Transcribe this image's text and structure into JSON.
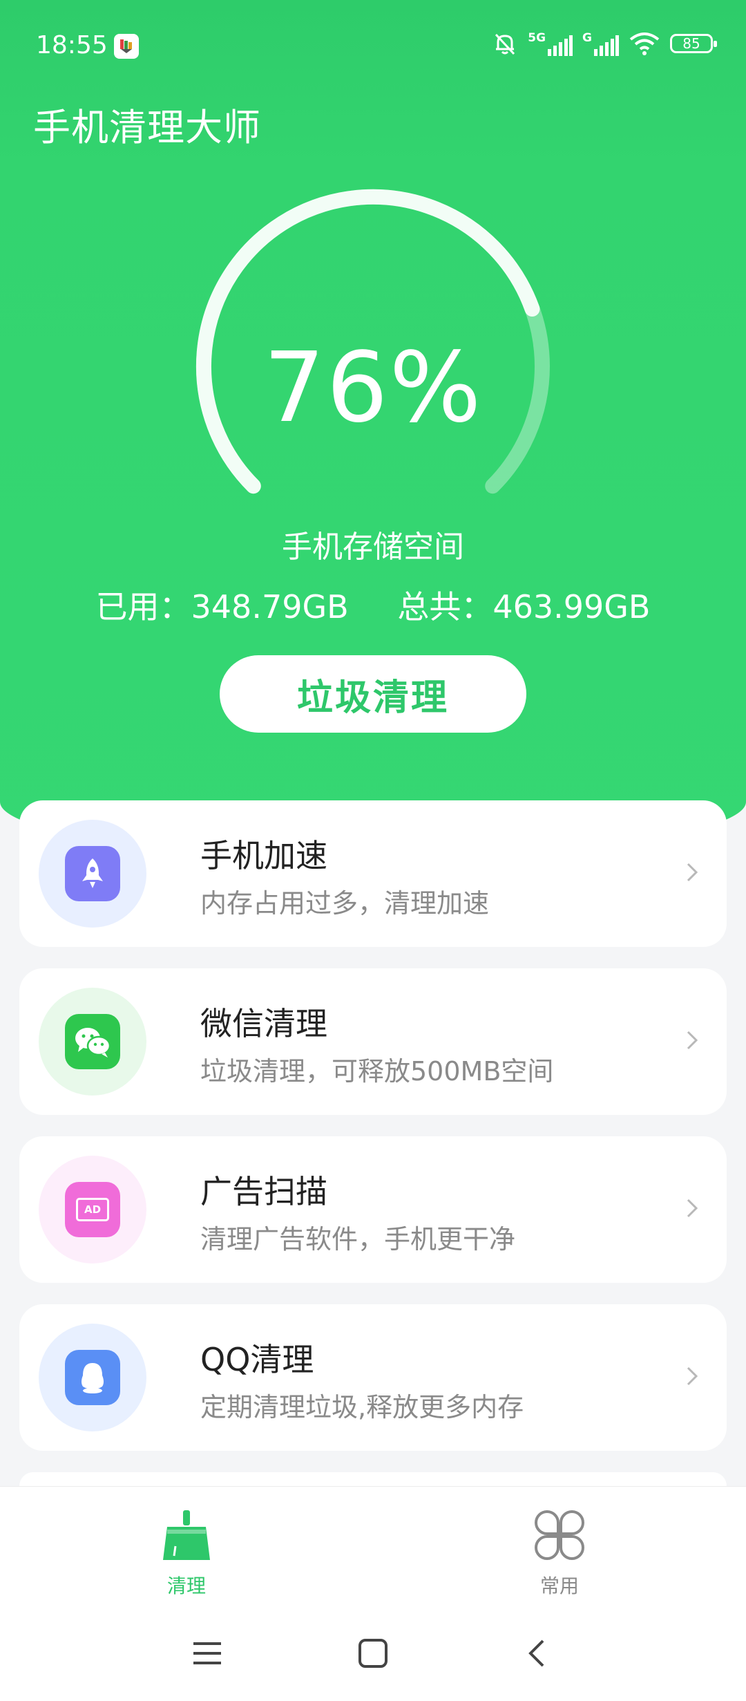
{
  "status_bar": {
    "time": "18:55",
    "network_5g": "5G",
    "network_g": "G",
    "battery": "85"
  },
  "app": {
    "title": "手机清理大师"
  },
  "storage": {
    "percent_text": "76%",
    "used_fraction": 0.76,
    "label": "手机存储空间",
    "used_text": "已用：348.79GB",
    "total_text": "总共：463.99GB",
    "clean_button": "垃圾清理"
  },
  "features": [
    {
      "title": "手机加速",
      "subtitle": "内存占用过多，清理加速",
      "icon": "rocket-icon",
      "color": "#7f7cf6",
      "bg": "#e8efff"
    },
    {
      "title": "微信清理",
      "subtitle": "垃圾清理，可释放500MB空间",
      "icon": "wechat-icon",
      "color": "#2ec74e",
      "bg": "#e8f9ea"
    },
    {
      "title": "广告扫描",
      "subtitle": "清理广告软件，手机更干净",
      "icon": "ad-icon",
      "icon_text": "AD",
      "color": "#f06cd9",
      "bg": "#fdeefb"
    },
    {
      "title": "QQ清理",
      "subtitle": "定期清理垃圾,释放更多内存",
      "icon": "qq-icon",
      "color": "#5a8ff5",
      "bg": "#e8f0ff"
    }
  ],
  "tabs": [
    {
      "label": "清理",
      "icon": "broom-icon",
      "active": true,
      "color": "#2ec76a"
    },
    {
      "label": "常用",
      "icon": "four-petal-icon",
      "active": false,
      "color": "#8a8a8a"
    }
  ],
  "colors": {
    "primary": "#34d472",
    "text": "#222222",
    "subtext": "#8a8a8a"
  }
}
